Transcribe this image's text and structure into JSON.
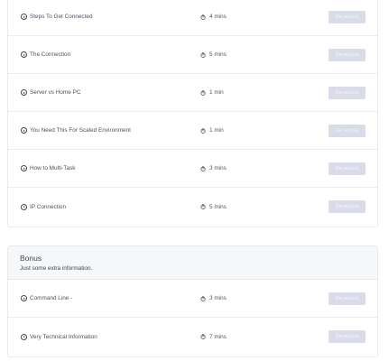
{
  "lessons": [
    {
      "title": "Steps To Get Connected",
      "duration": "4 mins",
      "button": "Get access"
    },
    {
      "title": "The Connection",
      "duration": "5 mins",
      "button": "Get access"
    },
    {
      "title": "Server vs Home PC",
      "duration": "1 min",
      "button": "Get access"
    },
    {
      "title": "You Need This For Scaled Environment",
      "duration": "1 min",
      "button": "Get access"
    },
    {
      "title": "How to Multi-Task",
      "duration": "3 mins",
      "button": "Get access"
    },
    {
      "title": "IP Connection",
      "duration": "5 mins",
      "button": "Get access"
    }
  ],
  "bonus": {
    "title": "Bonus",
    "subtitle": "Just some extra information.",
    "lessons": [
      {
        "title": "Command Line -",
        "duration": "3 mins",
        "button": "Get access"
      },
      {
        "title": "Very Technical Information",
        "duration": "7 mins",
        "button": "Get access"
      }
    ]
  },
  "colors": {
    "button_bg": "#d8dce8",
    "button_text": "#f5f6fa",
    "text": "#3d4451",
    "border": "#e7e9ef",
    "header_bg": "#f6f7f9"
  },
  "icons": {
    "lesson": "play-circle-icon",
    "duration": "stopwatch-icon"
  }
}
